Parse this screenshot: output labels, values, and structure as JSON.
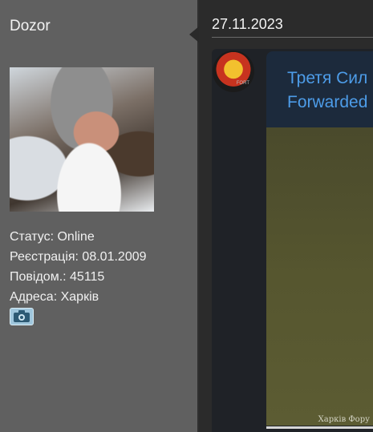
{
  "user": {
    "name": "Dozor",
    "status": "Статус: Online",
    "registration": "Реєстрація: 08.01.2009",
    "posts": "Повідом.: 45115",
    "address": "Адреса: Харків",
    "contact_icon": "camera-icon"
  },
  "post": {
    "date": "27.11.2023",
    "channel_label": "FORT",
    "title_line1": "Третя Сил",
    "title_line2": "Forwarded",
    "watermark": "Харків Фору"
  }
}
